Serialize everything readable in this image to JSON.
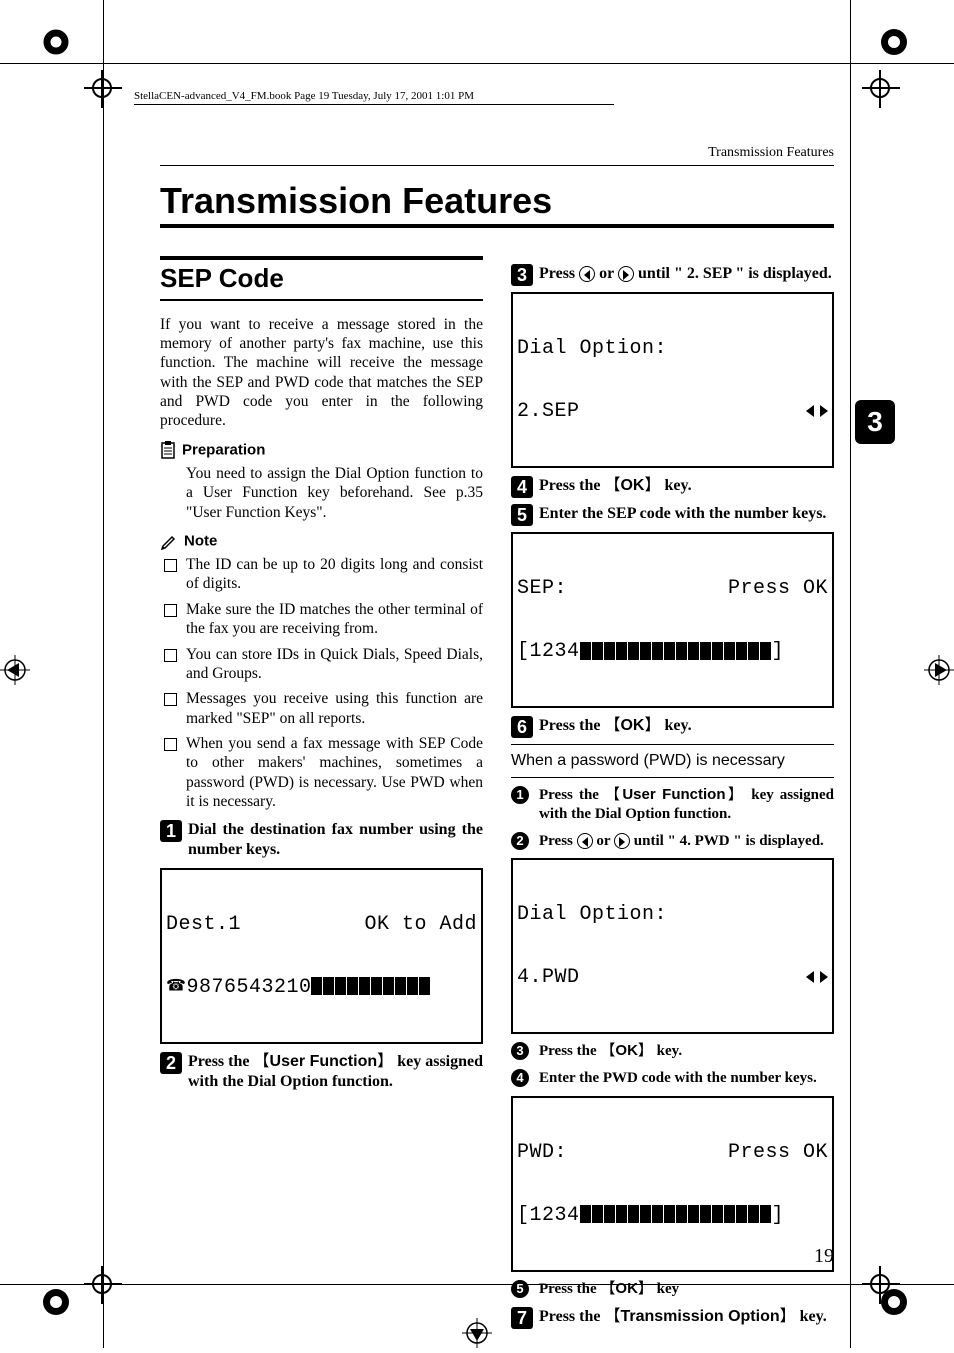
{
  "book_header": "StellaCEN-advanced_V4_FM.book  Page 19  Tuesday, July 17, 2001  1:01 PM",
  "running_head": "Transmission Features",
  "chapter_title": "Transmission Features",
  "section_title": "SEP Code",
  "intro_para": "If you want to receive a message stored in the memory of another party's fax machine, use this function. The machine will receive the message with the SEP and PWD code that matches the SEP and PWD code you enter in the following procedure.",
  "prep_label": "Preparation",
  "prep_text": "You need to assign the Dial Option function to a User Function key beforehand. See p.35 \"User Function Keys\".",
  "note_label": "Note",
  "notes": [
    "The ID can be up to 20 digits long and consist of digits.",
    "Make sure the ID matches the other terminal of the fax you are receiving from.",
    "You can store IDs in Quick Dials, Speed Dials, and Groups.",
    "Messages you receive using this function are marked \"SEP\" on all reports.",
    "When you send a fax message with SEP Code to other makers' machines, sometimes a password (PWD) is necessary. Use PWD when it is necessary."
  ],
  "steps_left": {
    "s1": "Dial the destination fax number using the number keys.",
    "s2_a": "Press the ",
    "s2_key": "User Function",
    "s2_b": " key assigned with the Dial Option function."
  },
  "steps_right": {
    "s3_a": "Press ",
    "s3_b": " or ",
    "s3_c": " until \" 2. SEP \" is displayed.",
    "s4_a": "Press the ",
    "s4_key": "OK",
    "s4_b": " key.",
    "s5": "Enter the SEP code with the number keys.",
    "s6_a": " Press the ",
    "s6_key": "OK",
    "s6_b": " key.",
    "s7_a": "Press the ",
    "s7_key": "Transmission Option",
    "s7_b": " key."
  },
  "lcd": {
    "dest": {
      "line1_left": "Dest.1",
      "line1_right": "OK to Add",
      "line2_prefix": "9876543210"
    },
    "dialopt_sep": {
      "line1": "Dial Option:",
      "line2": "2.SEP"
    },
    "sep_entry": {
      "line1_left": "SEP:",
      "line1_right": "Press OK",
      "line2_prefix": "[1234",
      "line2_suffix": "]"
    },
    "dialopt_pwd": {
      "line1": "Dial Option:",
      "line2": "4.PWD"
    },
    "pwd_entry": {
      "line1_left": "PWD:",
      "line1_right": "Press OK",
      "line2_prefix": "[1234",
      "line2_suffix": "]"
    }
  },
  "pwd_section": {
    "title": "When a password (PWD) is necessary",
    "p1_a": "Press the ",
    "p1_key": "User Function",
    "p1_b": " key assigned with the Dial Option function.",
    "p2_a": "Press ",
    "p2_b": " or ",
    "p2_c": " until \" 4. PWD \" is displayed.",
    "p3_a": "Press the ",
    "p3_key": "OK",
    "p3_b": " key.",
    "p4": "Enter the PWD code with the number keys.",
    "p5_a": "Press the ",
    "p5_key": "OK",
    "p5_b": " key"
  },
  "page_tab": "3",
  "page_number": "19"
}
